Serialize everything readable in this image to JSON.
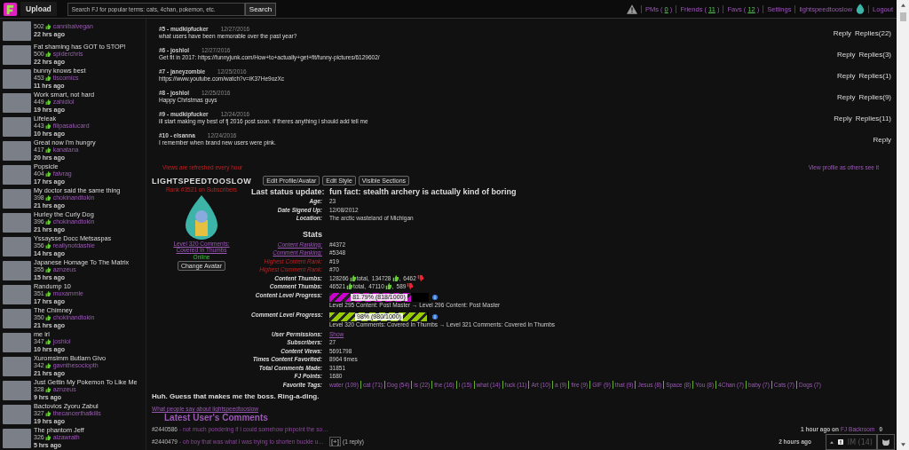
{
  "top_bar": {
    "upload": "Upload",
    "search_placeholder": "Search FJ for popular terms: cats, 4chan, pokemon, etc.",
    "search_button": "Search",
    "nav": [
      {
        "label": "PMs (",
        "count": "0",
        "suffix": ")"
      },
      {
        "label": "Friends (",
        "count": "11",
        "suffix": ")"
      },
      {
        "label": "Favs (",
        "count": "12",
        "suffix": ")"
      }
    ],
    "settings": "Settings",
    "username": "lightspeedtooslow",
    "logout": "Logout"
  },
  "sidebar": [
    {
      "count": "502",
      "user": "cannibalvegan",
      "time": "22 hrs ago"
    },
    {
      "title": "Fat shaming has GOT to STOP!",
      "count": "500",
      "user": "spiderchris",
      "time": "22 hrs ago"
    },
    {
      "title": "bunny knows best",
      "count": "453",
      "user": "tiscomics",
      "time": "11 hrs ago"
    },
    {
      "title": "Work smart, not hard",
      "count": "449",
      "user": "zahidlol",
      "time": "19 hrs ago"
    },
    {
      "title": "Lifeleak",
      "count": "443",
      "user": "filipasalucard",
      "time": "10 hrs ago"
    },
    {
      "title": "Great now I'm hungry",
      "count": "417",
      "user": "kanatana",
      "time": "20 hrs ago"
    },
    {
      "title": "Popsicle",
      "count": "404",
      "user": "falvrag",
      "time": "17 hrs ago"
    },
    {
      "title": "My doctor said the same thing",
      "count": "398",
      "user": "chokinandtokin",
      "time": "21 hrs ago"
    },
    {
      "title": "Hurley the Curly Dog",
      "count": "396",
      "user": "chokinandtokin",
      "time": "21 hrs ago"
    },
    {
      "title": "Yssaysse Docc Metsaspas",
      "count": "356",
      "user": "reallynotdashie",
      "time": "14 hrs ago"
    },
    {
      "title": "Japanese Homage To The Matrix",
      "count": "355",
      "user": "aznzeus",
      "time": "15 hrs ago"
    },
    {
      "title": "Randump 10",
      "count": "351",
      "user": "muxammle",
      "time": "17 hrs ago"
    },
    {
      "title": "The Chimney",
      "count": "350",
      "user": "chokinandtokin",
      "time": "21 hrs ago"
    },
    {
      "title": "me irl",
      "count": "347",
      "user": "joshlol",
      "time": "10 hrs ago"
    },
    {
      "title": "Xuromsimm Butlarn Givo",
      "count": "342",
      "user": "gavnthesociopth",
      "time": "21 hrs ago"
    },
    {
      "title": "Just Gettin My Pokemon To Like Me",
      "count": "328",
      "user": "aznzeus",
      "time": "9 hrs ago"
    },
    {
      "title": "Bactovios Zyoru Zabul",
      "count": "327",
      "user": "thecancerthatkills",
      "time": "19 hrs ago"
    },
    {
      "title": "The phantom Jeff",
      "count": "326",
      "user": "alzawrath",
      "time": "5 hrs ago"
    }
  ],
  "comments": [
    {
      "header": "#5 - mudkipfucker",
      "date": "12/27/2016",
      "text": "what users have been memorable over the past year?",
      "reply": "Reply",
      "replies": "Replies(22)"
    },
    {
      "header": "#6 - joshlol",
      "date": "12/27/2016",
      "text": "Get fit in 2017: https://funnyjunk.com/How+to+actually+get+fit/funny-pictures/6129602/",
      "reply": "Reply",
      "replies": "Replies(3)"
    },
    {
      "header": "#7 - janeyzombie",
      "date": "12/25/2016",
      "text": "https://www.youtube.com/watch?v=iK37He9ozXc",
      "reply": "Reply",
      "replies": "Replies(1)"
    },
    {
      "header": "#8 - joshlol",
      "date": "12/25/2016",
      "text": "Happy Christmas guys",
      "reply": "Reply",
      "replies": "Replies(9)"
    },
    {
      "header": "#9 - mudkipfucker",
      "date": "12/24/2016",
      "text": "ill start making my best of fj 2016 post soon. if theres anything i should add tell me",
      "reply": "Reply",
      "replies": "Replies(11)"
    },
    {
      "header": "#10 - elsanna",
      "date": "12/24/2016",
      "text": "I remember when brand new users were pink.",
      "reply": "Reply"
    }
  ],
  "views_note": "Views are refreshed every hour",
  "view_as_others": "View profile as others see it",
  "profile": {
    "username": "LIGHTSPEEDTOOSLOW",
    "buttons": [
      "Edit Profile/Avatar",
      "Edit Style",
      "Visible Sections"
    ],
    "rank": "Rank #3521 on Subscribers",
    "level_link": "Level 320 Comments: Covered In Thumbs",
    "status": "Online",
    "change_avatar": "Change Avatar",
    "fields": [
      {
        "kind": "status",
        "label": "Last status update:",
        "value": "fun fact: stealth archery is actually kind of boring"
      },
      {
        "kind": "plain",
        "label": "Age:",
        "value": "23"
      },
      {
        "kind": "plain",
        "label": "Date Signed Up:",
        "value": "12/08/2012"
      },
      {
        "kind": "plain",
        "label": "Location:",
        "value": "The arctic wasteland of Michigan"
      },
      {
        "kind": "heading",
        "label": "Stats"
      },
      {
        "kind": "ranking",
        "label": "Content Ranking:",
        "value": "#4372"
      },
      {
        "kind": "ranking",
        "label": "Comment Ranking:",
        "value": "#5348"
      },
      {
        "kind": "highest",
        "label": "Highest Content Rank:",
        "value": "#19"
      },
      {
        "kind": "highest",
        "label": "Highest Comment Rank:",
        "value": "#70"
      },
      {
        "kind": "thumbs",
        "label": "Content Thumbs:",
        "total": "128266",
        "total_word": "total,",
        "up": "134728",
        "sep": ",",
        "down": "6462"
      },
      {
        "kind": "thumbs",
        "label": "Comment Thumbs:",
        "total": "46521",
        "total_word": "total,",
        "up": "47110",
        "sep": ",",
        "down": "589"
      },
      {
        "kind": "progress",
        "label": "Content Level Progress:",
        "bar_text": "81.79% (818/1000)",
        "level": 0.8179,
        "color": "#cc00cc",
        "caption": "Level 295 Content: Post Master → Level 296 Content: Post Master"
      },
      {
        "kind": "progress",
        "label": "Comment Level Progress:",
        "bar_text": "98% (980/1000)",
        "level": 0.98,
        "color": "#99cc00",
        "caption": "Level 320 Comments: Covered In Thumbs → Level 321 Comments: Covered In Thumbs"
      },
      {
        "kind": "link",
        "label": "User Permissions:",
        "value": "Show"
      },
      {
        "kind": "plain",
        "label": "Subscribers:",
        "value": "27"
      },
      {
        "kind": "plain",
        "label": "Content Views:",
        "value": "5691798"
      },
      {
        "kind": "plain",
        "label": "Times Content Favorited:",
        "value": "8964 times"
      },
      {
        "kind": "plain",
        "label": "Total Comments Made:",
        "value": "31851"
      },
      {
        "kind": "plain",
        "label": "FJ Points:",
        "value": "1680"
      },
      {
        "kind": "tags",
        "label": "Favorite Tags:",
        "tags": [
          "water (109)",
          "cat (71)",
          "Dog (54)",
          "is (22)",
          "the (16)",
          "i (15)",
          "what (14)",
          "fuck (11)",
          "Art (10)",
          "a (9)",
          "fire (9)",
          "GIF (9)",
          "that (9)",
          "Jesus (8)",
          "Space (8)",
          "You (8)",
          "4Chan (7)",
          "baby (7)",
          "Cats (7)",
          "Dogs (7)"
        ]
      }
    ],
    "motto": "Huh. Guess that makes me the boss. Ring-a-ding.",
    "about_link": "What people say about lightspeedtooslow"
  },
  "latest": {
    "title": "Latest User's Comments",
    "items": [
      {
        "id": "#2440586",
        "text": "- not much pondering if I could somehow pinpoint the so…",
        "time": "1 hour ago on",
        "where": "FJ Backroom",
        "score": "0"
      },
      {
        "id": "#2440479",
        "text": "- oh boy that was what I was trying to shorten buckle u…",
        "expand": "[+]",
        "replies": "(1 reply)",
        "time": "2 hours ago"
      }
    ]
  },
  "im_bar": {
    "label": "IM (14)"
  }
}
